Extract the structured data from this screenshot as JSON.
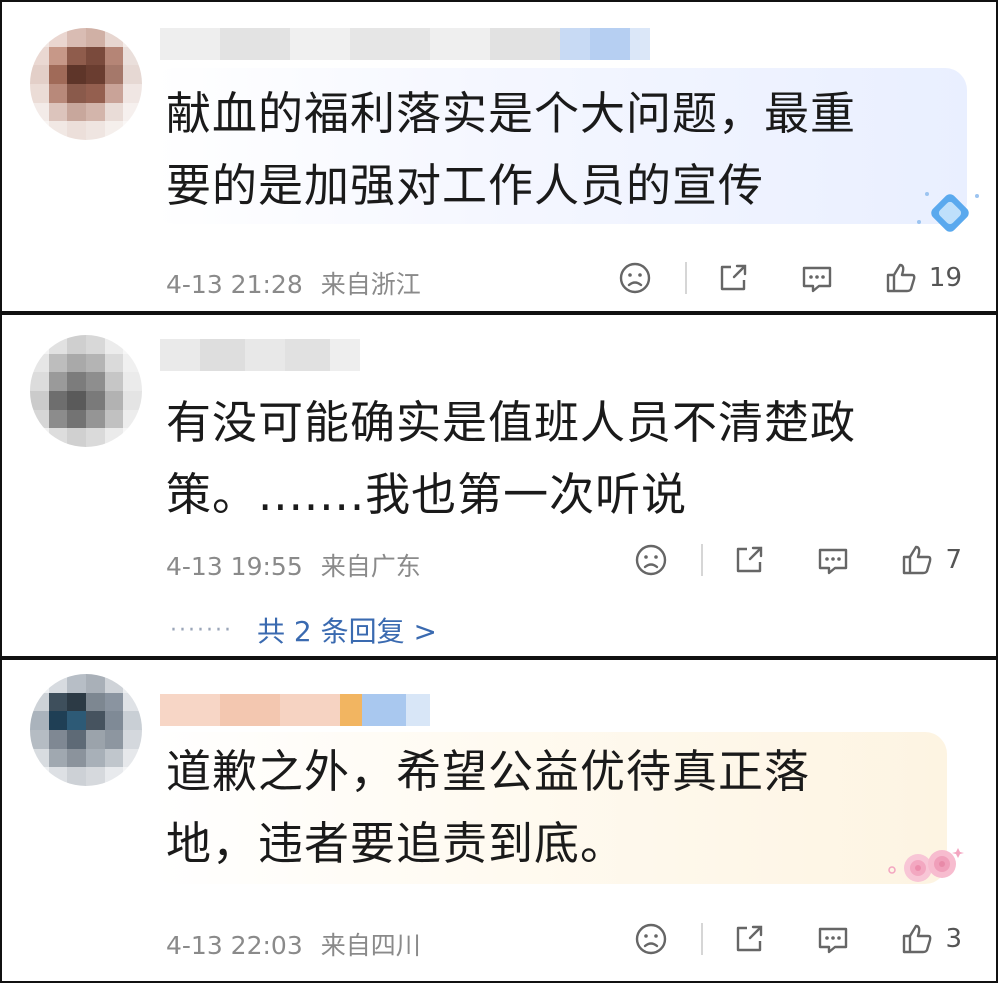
{
  "comments": [
    {
      "text_lines": [
        "献血的福利落实是个大问题，最重",
        "要的是加强对工作人员的宣传"
      ],
      "time": "4-13 21:28",
      "location": "来自浙江",
      "likes": "19"
    },
    {
      "text_lines": [
        "有没可能确实是值班人员不清楚政",
        "策。.......我也第一次听说"
      ],
      "time": "4-13 19:55",
      "location": "来自广东",
      "likes": "7",
      "replies": {
        "dots": "·······",
        "label": "共 2 条回复 >"
      }
    },
    {
      "text_lines": [
        "道歉之外，希望公益优待真正落",
        "地，违者要追责到底。"
      ],
      "time": "4-13 22:03",
      "location": "来自四川",
      "likes": "3"
    }
  ],
  "icons": {
    "dislike": "frown-icon",
    "repost": "share-icon",
    "comment": "comment-icon",
    "like": "thumbs-up-icon",
    "badge1": "diamond-badge-icon",
    "badge3": "rose-badge-icon"
  },
  "colors": {
    "reply_link": "#3a6ab0",
    "meta_text": "#8a8a8a",
    "border": "#111111"
  }
}
